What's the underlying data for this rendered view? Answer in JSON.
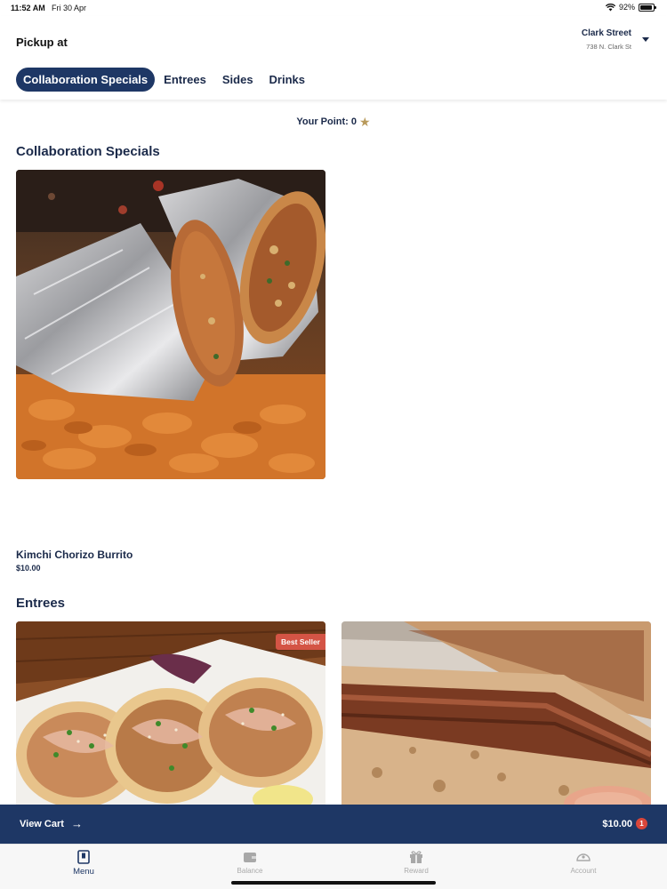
{
  "status_bar": {
    "time": "11:52 AM",
    "date": "Fri 30 Apr",
    "battery": "92%",
    "battery_level": 0.92
  },
  "header": {
    "pickup_label": "Pickup at",
    "store_name": "Clark Street",
    "store_address": "738 N. Clark St"
  },
  "tabs": [
    {
      "label": "Collaboration Specials",
      "active": true
    },
    {
      "label": "Entrees",
      "active": false
    },
    {
      "label": "Sides",
      "active": false
    },
    {
      "label": "Drinks",
      "active": false
    }
  ],
  "points": {
    "label": "Your Point: 0"
  },
  "sections": [
    {
      "title": "Collaboration Specials",
      "items": [
        {
          "name": "Kimchi Chorizo Burrito",
          "price": "$10.00"
        }
      ]
    },
    {
      "title": "Entrees",
      "items": [
        {
          "badge": "Best Seller"
        },
        {}
      ]
    }
  ],
  "cart": {
    "label": "View Cart",
    "total": "$10.00",
    "count": "1"
  },
  "bottom_nav": [
    {
      "label": "Menu",
      "icon": "menu-book-icon",
      "active": true
    },
    {
      "label": "Balance",
      "icon": "wallet-icon",
      "active": false
    },
    {
      "label": "Reward",
      "icon": "gift-icon",
      "active": false
    },
    {
      "label": "Account",
      "icon": "account-icon",
      "active": false
    }
  ],
  "colors": {
    "primary": "#1e3765",
    "badge": "#d45445",
    "star": "#b99a5b"
  }
}
